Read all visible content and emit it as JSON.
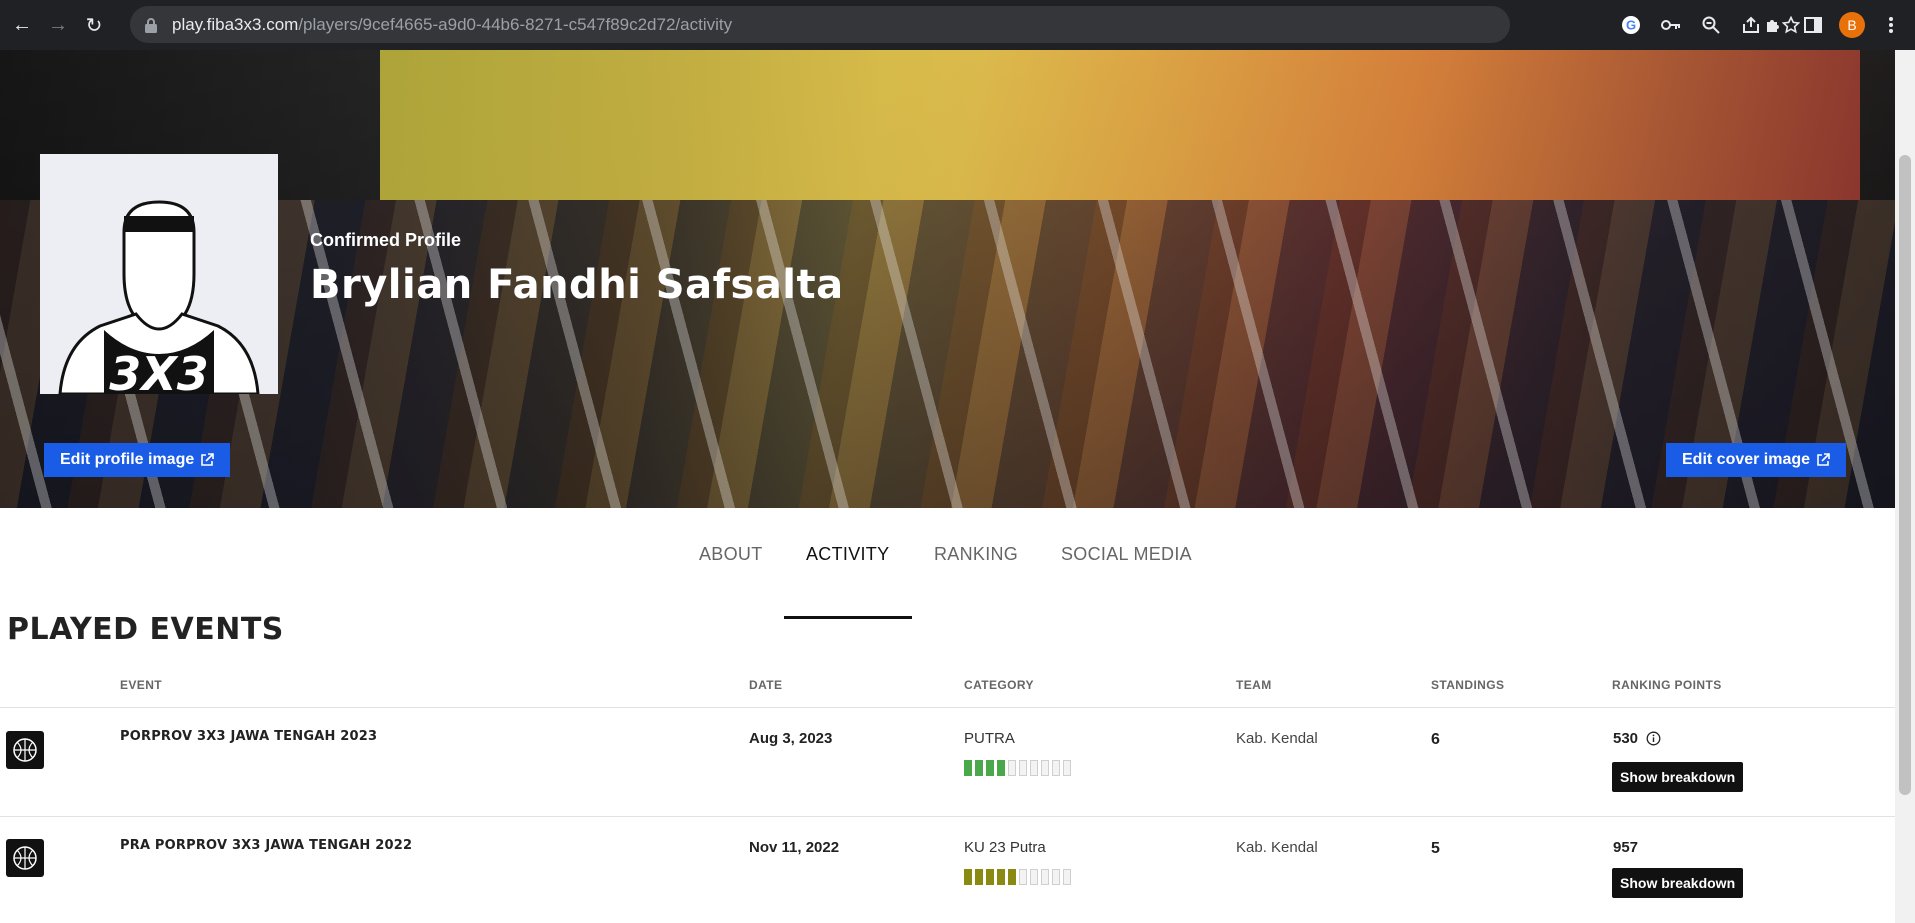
{
  "browser": {
    "url_host": "play.fiba3x3.com",
    "url_path": "/players/9cef4665-a9d0-44b6-8271-c547f89c2d72/activity",
    "profile_initial": "B"
  },
  "profile": {
    "confirmed_label": "Confirmed Profile",
    "name": "Brylian Fandhi Safsalta",
    "edit_profile_label": "Edit profile image",
    "edit_cover_label": "Edit cover image"
  },
  "tabs": [
    {
      "label": "ABOUT"
    },
    {
      "label": "ACTIVITY"
    },
    {
      "label": "RANKING"
    },
    {
      "label": "SOCIAL MEDIA"
    }
  ],
  "section_title": "PLAYED EVENTS",
  "table": {
    "headers": {
      "event": "EVENT",
      "date": "DATE",
      "category": "CATEGORY",
      "team": "TEAM",
      "standings": "STANDINGS",
      "ranking_points": "RANKING POINTS"
    },
    "rows": [
      {
        "event": "PORPROV 3X3 JAWA TENGAH 2023",
        "date": "Aug 3, 2023",
        "category": "PUTRA",
        "category_level": 4,
        "level_color": "#4aa84a",
        "team": "Kab. Kendal",
        "standings": "6",
        "points": "530",
        "breakdown_label": "Show breakdown"
      },
      {
        "event": "PRA PORPROV 3X3 JAWA TENGAH 2022",
        "date": "Nov 11, 2022",
        "category": "KU 23 Putra",
        "category_level": 5,
        "level_color": "#8a8a12",
        "team": "Kab. Kendal",
        "standings": "5",
        "points": "957",
        "breakdown_label": "Show breakdown"
      }
    ]
  },
  "colors": {
    "accent_button": "#1a5ce6",
    "dark_button": "#111111"
  }
}
